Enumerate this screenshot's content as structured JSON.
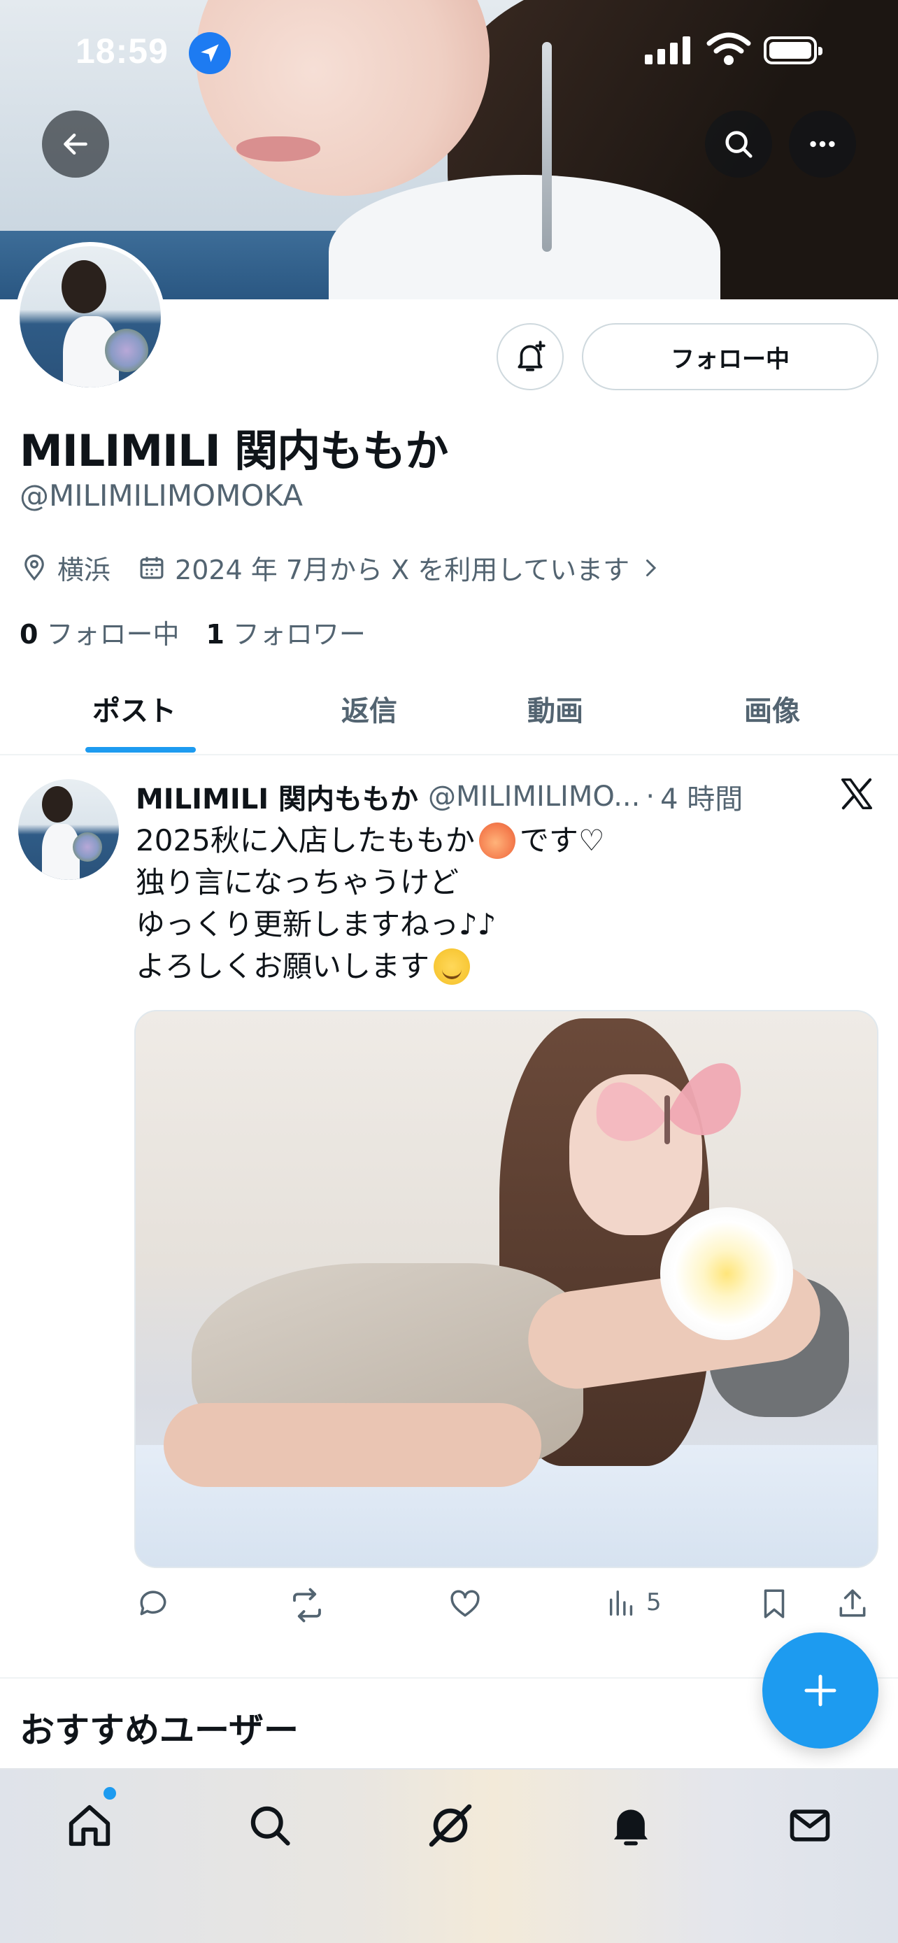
{
  "status_bar": {
    "time": "18:59"
  },
  "profile": {
    "display_name": "MILIMILI 関内ももか",
    "handle": "@MILIMILIMOMOKA",
    "location": "横浜",
    "joined": "2024 年 7月から X を利用しています",
    "following_count": "0",
    "following_label": "フォロー中",
    "followers_count": "1",
    "followers_label": "フォロワー",
    "follow_button_label": "フォロー中"
  },
  "tabs": [
    {
      "label": "ポスト",
      "active": true
    },
    {
      "label": "返信",
      "active": false
    },
    {
      "label": "動画",
      "active": false
    },
    {
      "label": "画像",
      "active": false
    }
  ],
  "post": {
    "author_name": "MILIMILI 関内ももか",
    "author_handle": "@MILIMILIMO...",
    "time_separator": "·",
    "time": "4 時間",
    "lines": [
      {
        "before": "2025秋に入店したももか",
        "emoji": "peach",
        "after": "です♡"
      },
      {
        "before": "独り言になっちゃうけど",
        "emoji": "",
        "after": ""
      },
      {
        "before": "ゆっくり更新しますねっ♪♪",
        "emoji": "",
        "after": ""
      },
      {
        "before": "よろしくお願いします",
        "emoji": "smile",
        "after": ""
      }
    ],
    "views_count": "5"
  },
  "recommend_heading": "おすすめユーザー",
  "colors": {
    "accent": "#1d9bf0",
    "text": "#0f1419",
    "secondary": "#536471"
  },
  "icons": {
    "back": "arrow-left-icon",
    "search": "search-icon",
    "more": "more-horizontal-icon",
    "bell": "bell-plus-icon",
    "location": "map-pin-icon",
    "calendar": "calendar-icon",
    "reply": "reply-icon",
    "repost": "repost-icon",
    "like": "heart-icon",
    "views": "bar-chart-icon",
    "bookmark": "bookmark-icon",
    "share": "share-icon",
    "compose": "plus-icon",
    "nav": [
      "home-icon",
      "search-icon",
      "grok-icon",
      "bell-icon",
      "mail-icon"
    ]
  }
}
